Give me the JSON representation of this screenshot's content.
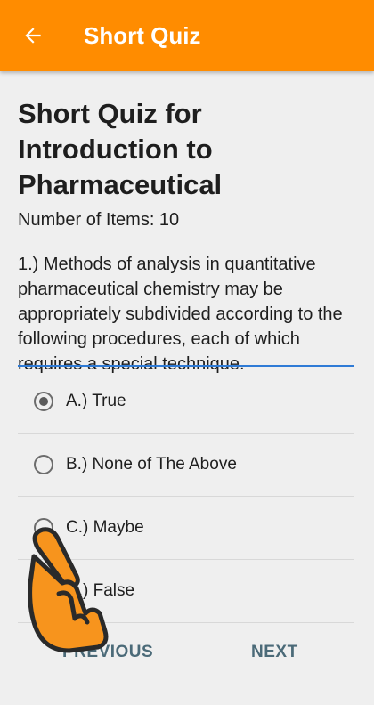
{
  "appbar": {
    "back_icon": "arrow-left-icon",
    "title": "Short Quiz",
    "color": "#ff8c00"
  },
  "quiz": {
    "title": "Short Quiz for Introduction to Pharmaceutical",
    "items_count": "Number of Items: 10",
    "question": "1.) Methods of analysis in quantitative pharmaceutical chemistry may be appropriately subdivided according to the following procedures, each of which requires a special technique."
  },
  "options": [
    {
      "label": "A.) True",
      "selected": true
    },
    {
      "label": "B.) None of The Above",
      "selected": false
    },
    {
      "label": "C.) Maybe",
      "selected": false
    },
    {
      "label": "D.) False",
      "selected": false
    }
  ],
  "nav": {
    "previous": "PREVIOUS",
    "next": "NEXT"
  },
  "overlay": {
    "icon": "pointing-hand-icon"
  }
}
